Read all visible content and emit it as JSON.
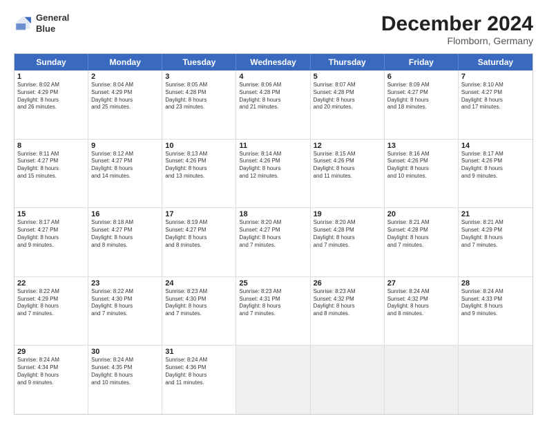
{
  "header": {
    "logo_line1": "General",
    "logo_line2": "Blue",
    "month": "December 2024",
    "location": "Flomborn, Germany"
  },
  "weekdays": [
    "Sunday",
    "Monday",
    "Tuesday",
    "Wednesday",
    "Thursday",
    "Friday",
    "Saturday"
  ],
  "rows": [
    [
      {
        "day": "1",
        "lines": [
          "Sunrise: 8:02 AM",
          "Sunset: 4:29 PM",
          "Daylight: 8 hours",
          "and 26 minutes."
        ]
      },
      {
        "day": "2",
        "lines": [
          "Sunrise: 8:04 AM",
          "Sunset: 4:29 PM",
          "Daylight: 8 hours",
          "and 25 minutes."
        ]
      },
      {
        "day": "3",
        "lines": [
          "Sunrise: 8:05 AM",
          "Sunset: 4:28 PM",
          "Daylight: 8 hours",
          "and 23 minutes."
        ]
      },
      {
        "day": "4",
        "lines": [
          "Sunrise: 8:06 AM",
          "Sunset: 4:28 PM",
          "Daylight: 8 hours",
          "and 21 minutes."
        ]
      },
      {
        "day": "5",
        "lines": [
          "Sunrise: 8:07 AM",
          "Sunset: 4:28 PM",
          "Daylight: 8 hours",
          "and 20 minutes."
        ]
      },
      {
        "day": "6",
        "lines": [
          "Sunrise: 8:09 AM",
          "Sunset: 4:27 PM",
          "Daylight: 8 hours",
          "and 18 minutes."
        ]
      },
      {
        "day": "7",
        "lines": [
          "Sunrise: 8:10 AM",
          "Sunset: 4:27 PM",
          "Daylight: 8 hours",
          "and 17 minutes."
        ]
      }
    ],
    [
      {
        "day": "8",
        "lines": [
          "Sunrise: 8:11 AM",
          "Sunset: 4:27 PM",
          "Daylight: 8 hours",
          "and 15 minutes."
        ]
      },
      {
        "day": "9",
        "lines": [
          "Sunrise: 8:12 AM",
          "Sunset: 4:27 PM",
          "Daylight: 8 hours",
          "and 14 minutes."
        ]
      },
      {
        "day": "10",
        "lines": [
          "Sunrise: 8:13 AM",
          "Sunset: 4:26 PM",
          "Daylight: 8 hours",
          "and 13 minutes."
        ]
      },
      {
        "day": "11",
        "lines": [
          "Sunrise: 8:14 AM",
          "Sunset: 4:26 PM",
          "Daylight: 8 hours",
          "and 12 minutes."
        ]
      },
      {
        "day": "12",
        "lines": [
          "Sunrise: 8:15 AM",
          "Sunset: 4:26 PM",
          "Daylight: 8 hours",
          "and 11 minutes."
        ]
      },
      {
        "day": "13",
        "lines": [
          "Sunrise: 8:16 AM",
          "Sunset: 4:26 PM",
          "Daylight: 8 hours",
          "and 10 minutes."
        ]
      },
      {
        "day": "14",
        "lines": [
          "Sunrise: 8:17 AM",
          "Sunset: 4:26 PM",
          "Daylight: 8 hours",
          "and 9 minutes."
        ]
      }
    ],
    [
      {
        "day": "15",
        "lines": [
          "Sunrise: 8:17 AM",
          "Sunset: 4:27 PM",
          "Daylight: 8 hours",
          "and 9 minutes."
        ]
      },
      {
        "day": "16",
        "lines": [
          "Sunrise: 8:18 AM",
          "Sunset: 4:27 PM",
          "Daylight: 8 hours",
          "and 8 minutes."
        ]
      },
      {
        "day": "17",
        "lines": [
          "Sunrise: 8:19 AM",
          "Sunset: 4:27 PM",
          "Daylight: 8 hours",
          "and 8 minutes."
        ]
      },
      {
        "day": "18",
        "lines": [
          "Sunrise: 8:20 AM",
          "Sunset: 4:27 PM",
          "Daylight: 8 hours",
          "and 7 minutes."
        ]
      },
      {
        "day": "19",
        "lines": [
          "Sunrise: 8:20 AM",
          "Sunset: 4:28 PM",
          "Daylight: 8 hours",
          "and 7 minutes."
        ]
      },
      {
        "day": "20",
        "lines": [
          "Sunrise: 8:21 AM",
          "Sunset: 4:28 PM",
          "Daylight: 8 hours",
          "and 7 minutes."
        ]
      },
      {
        "day": "21",
        "lines": [
          "Sunrise: 8:21 AM",
          "Sunset: 4:29 PM",
          "Daylight: 8 hours",
          "and 7 minutes."
        ]
      }
    ],
    [
      {
        "day": "22",
        "lines": [
          "Sunrise: 8:22 AM",
          "Sunset: 4:29 PM",
          "Daylight: 8 hours",
          "and 7 minutes."
        ]
      },
      {
        "day": "23",
        "lines": [
          "Sunrise: 8:22 AM",
          "Sunset: 4:30 PM",
          "Daylight: 8 hours",
          "and 7 minutes."
        ]
      },
      {
        "day": "24",
        "lines": [
          "Sunrise: 8:23 AM",
          "Sunset: 4:30 PM",
          "Daylight: 8 hours",
          "and 7 minutes."
        ]
      },
      {
        "day": "25",
        "lines": [
          "Sunrise: 8:23 AM",
          "Sunset: 4:31 PM",
          "Daylight: 8 hours",
          "and 7 minutes."
        ]
      },
      {
        "day": "26",
        "lines": [
          "Sunrise: 8:23 AM",
          "Sunset: 4:32 PM",
          "Daylight: 8 hours",
          "and 8 minutes."
        ]
      },
      {
        "day": "27",
        "lines": [
          "Sunrise: 8:24 AM",
          "Sunset: 4:32 PM",
          "Daylight: 8 hours",
          "and 8 minutes."
        ]
      },
      {
        "day": "28",
        "lines": [
          "Sunrise: 8:24 AM",
          "Sunset: 4:33 PM",
          "Daylight: 8 hours",
          "and 9 minutes."
        ]
      }
    ],
    [
      {
        "day": "29",
        "lines": [
          "Sunrise: 8:24 AM",
          "Sunset: 4:34 PM",
          "Daylight: 8 hours",
          "and 9 minutes."
        ]
      },
      {
        "day": "30",
        "lines": [
          "Sunrise: 8:24 AM",
          "Sunset: 4:35 PM",
          "Daylight: 8 hours",
          "and 10 minutes."
        ]
      },
      {
        "day": "31",
        "lines": [
          "Sunrise: 8:24 AM",
          "Sunset: 4:36 PM",
          "Daylight: 8 hours",
          "and 11 minutes."
        ]
      },
      {
        "day": "",
        "lines": []
      },
      {
        "day": "",
        "lines": []
      },
      {
        "day": "",
        "lines": []
      },
      {
        "day": "",
        "lines": []
      }
    ]
  ]
}
